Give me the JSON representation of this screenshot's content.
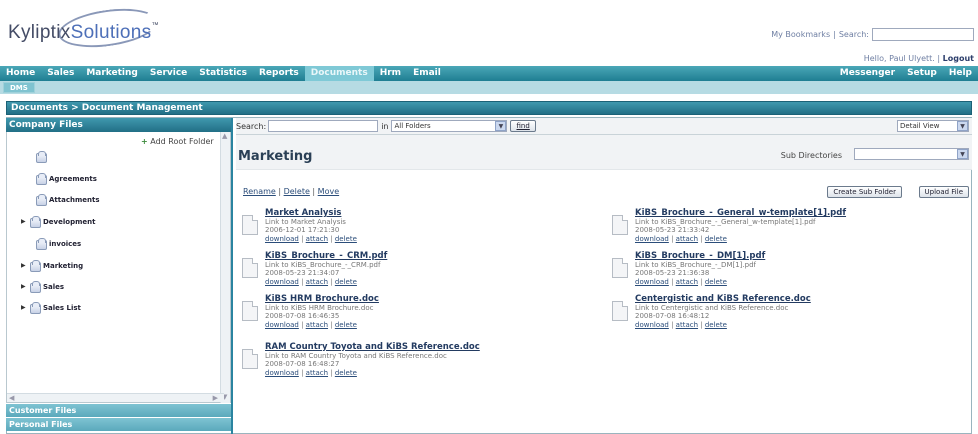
{
  "brand": {
    "logo_text_a": "Kyliptix",
    "logo_text_b": "Solutions",
    "tm": "™"
  },
  "header": {
    "bookmarks": "My Bookmarks",
    "sep": "|",
    "search_label": "Search:",
    "search_value": "",
    "hello": "Hello, Paul Ulyett.",
    "logout": "Logout"
  },
  "nav": {
    "left": [
      "Home",
      "Sales",
      "Marketing",
      "Service",
      "Statistics",
      "Reports",
      "Documents",
      "Hrm",
      "Email"
    ],
    "active": "Documents",
    "right": [
      "Messenger",
      "Setup",
      "Help"
    ]
  },
  "subnav": {
    "tab": "DMS"
  },
  "breadcrumb": "Documents > Document Management",
  "sidebar": {
    "header": "Company Files",
    "add_root": "Add Root Folder",
    "folders": [
      {
        "label": "",
        "expandable": false
      },
      {
        "label": "Agreements",
        "expandable": false
      },
      {
        "label": "Attachments",
        "expandable": false
      },
      {
        "label": "Development",
        "expandable": true
      },
      {
        "label": "invoices",
        "expandable": false
      },
      {
        "label": "Marketing",
        "expandable": true
      },
      {
        "label": "Sales",
        "expandable": true
      },
      {
        "label": "Sales List",
        "expandable": true
      }
    ],
    "sections": [
      "Customer Files",
      "Personal Files"
    ]
  },
  "toolbar": {
    "search_label": "Search:",
    "search_value": "",
    "in_label": "in",
    "folder_select": "All Folders",
    "find": "find",
    "view_select": "Detail View"
  },
  "folder": {
    "title": "Marketing",
    "subdir_label": "Sub Directories",
    "subdir_value": "",
    "actions": [
      "Rename",
      "Delete",
      "Move"
    ],
    "create_btn": "Create Sub Folder",
    "upload_btn": "Upload File"
  },
  "doc_links": {
    "download": "download",
    "attach": "attach",
    "delete": "delete"
  },
  "documents": [
    {
      "name": "Market Analysis",
      "link": "Link to Market Analysis",
      "date": "2006-12-01 17:21:30"
    },
    {
      "name": "KiBS_Brochure_-_General_w-template[1].pdf",
      "link": "Link to KiBS_Brochure_-_General_w-template[1].pdf",
      "date": "2008-05-23 21:33:42"
    },
    {
      "name": "KiBS_Brochure_-_CRM.pdf",
      "link": "Link to KiBS_Brochure_-_CRM.pdf",
      "date": "2008-05-23 21:34:07"
    },
    {
      "name": "KiBS_Brochure_-_DM[1].pdf",
      "link": "Link to KiBS_Brochure_-_DM[1].pdf",
      "date": "2008-05-23 21:36:38"
    },
    {
      "name": "KiBS HRM Brochure.doc",
      "link": "Link to KiBS HRM Brochure.doc",
      "date": "2008-07-08 16:46:35"
    },
    {
      "name": "Centergistic and KiBS Reference.doc",
      "link": "Link to Centergistic and KiBS Reference.doc",
      "date": "2008-07-08 16:48:12"
    },
    {
      "name": "RAM Country Toyota and KiBS Reference.doc",
      "link": "Link to RAM Country Toyota and KiBS Reference.doc",
      "date": "2008-07-08 16:48:27"
    }
  ]
}
